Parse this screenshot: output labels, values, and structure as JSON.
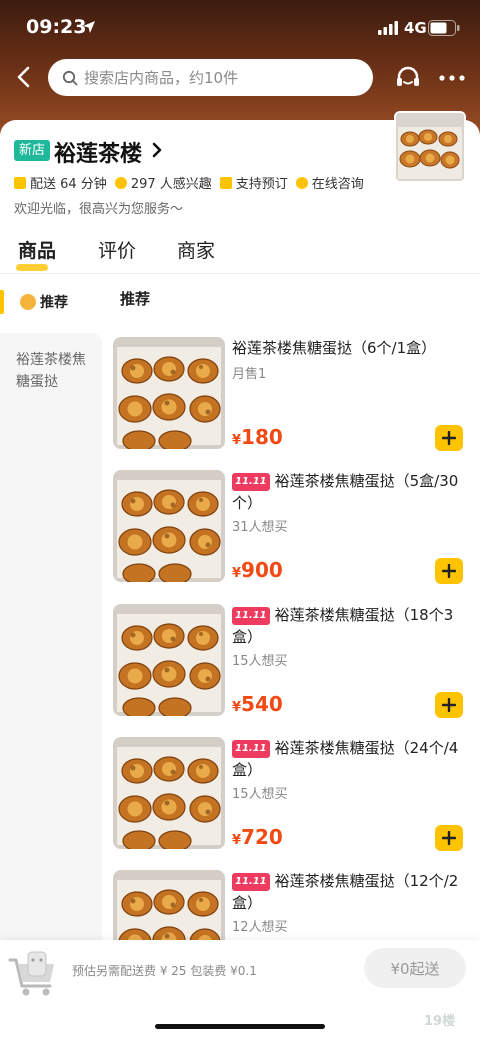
{
  "status_bar": {
    "time": "09:23",
    "network": "4G"
  },
  "search": {
    "placeholder": "搜索店内商品，约10件"
  },
  "store": {
    "badge": "新店",
    "name": "裕莲茶楼",
    "info": [
      {
        "icon": "delivery-icon",
        "text": "配送 64 分钟"
      },
      {
        "icon": "interest-icon",
        "text": "297 人感兴趣"
      },
      {
        "icon": "reserve-icon",
        "text": "支持预订"
      },
      {
        "icon": "chat-icon",
        "text": "在线咨询"
      }
    ],
    "welcome": "欢迎光临，很高兴为您服务～"
  },
  "tabs": [
    {
      "label": "商品",
      "active": true
    },
    {
      "label": "评价",
      "active": false
    },
    {
      "label": "商家",
      "active": false
    }
  ],
  "sidebar": {
    "items": [
      {
        "label": "推荐",
        "active": true
      },
      {
        "label": "裕莲茶楼焦糖蛋挞",
        "active": false
      }
    ]
  },
  "section_title": "推荐",
  "products": [
    {
      "promo": "",
      "title": "裕莲茶楼焦糖蛋挞（6个/1盒）",
      "sub": "月售1",
      "currency": "¥",
      "price": "180"
    },
    {
      "promo": "11.11",
      "title": "裕莲茶楼焦糖蛋挞（5盒/30个）",
      "sub": "31人想买",
      "currency": "¥",
      "price": "900"
    },
    {
      "promo": "11.11",
      "title": "裕莲茶楼焦糖蛋挞（18个3盒）",
      "sub": "15人想买",
      "currency": "¥",
      "price": "540"
    },
    {
      "promo": "11.11",
      "title": "裕莲茶楼焦糖蛋挞（24个/4盒）",
      "sub": "15人想买",
      "currency": "¥",
      "price": "720"
    },
    {
      "promo": "11.11",
      "title": "裕莲茶楼焦糖蛋挞（12个/2盒）",
      "sub": "12人想买",
      "currency": "¥",
      "price": ""
    }
  ],
  "bottom_bar": {
    "fee_text": "预估另需配送费 ¥ 25   包装费 ¥0.1",
    "checkout_label": "¥0起送"
  },
  "watermark": "19楼",
  "colors": {
    "accent": "#ffc300",
    "price": "#f14a15",
    "new_badge": "#1fb89a",
    "promo": "#ef3b5f"
  }
}
